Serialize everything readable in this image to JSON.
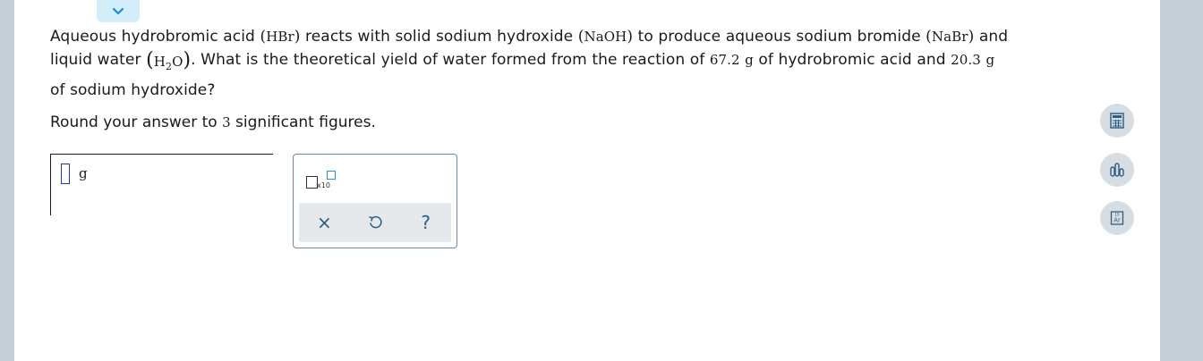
{
  "question": {
    "line1": {
      "t1": "Aqueous hydrobromic acid ",
      "f1": "HBr",
      "t2": " reacts with solid sodium hydroxide ",
      "f2": "NaOH",
      "t3": " to produce aqueous sodium bromide ",
      "f3": "NaBr",
      "t4": " and"
    },
    "line2": {
      "t1": "liquid water ",
      "f_h": "H",
      "f_sub": "2",
      "f_o": "O",
      "t2": ". What is the theoretical yield of water formed from the reaction of ",
      "n1": "67.2",
      "u1": "g",
      "t3": " of hydrobromic acid and ",
      "n2": "20.3",
      "u2": "g"
    },
    "line3": "of sodium hydroxide?"
  },
  "instruction": {
    "prefix": "Round your answer to ",
    "number": "3",
    "suffix": " significant figures."
  },
  "answer": {
    "value": "",
    "unit": "g"
  },
  "toolbox": {
    "sci_label": "x10",
    "clear_symbol": "×",
    "help_symbol": "?"
  },
  "side_tools": {
    "periodic_mass": "19",
    "periodic_symbol": "Ar"
  },
  "colors": {
    "accent": "#2b5c86",
    "tab": "#d3eef8",
    "sidebar_bg": "#c4ced5"
  }
}
